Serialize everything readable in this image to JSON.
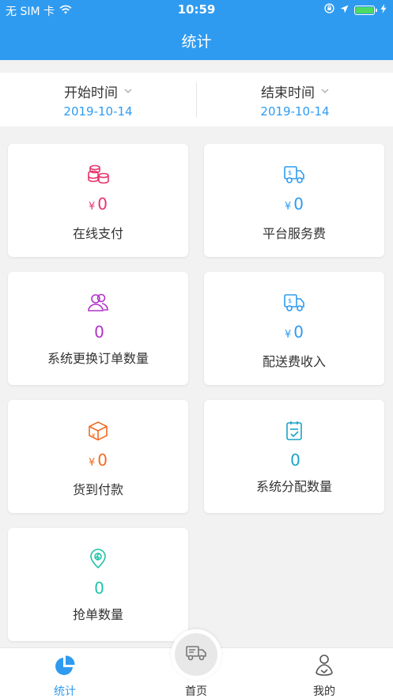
{
  "status_bar": {
    "carrier": "无 SIM 卡",
    "time": "10:59"
  },
  "header": {
    "title": "统计"
  },
  "date_filter": {
    "start_label": "开始时间",
    "start_value": "2019-10-14",
    "end_label": "结束时间",
    "end_value": "2019-10-14"
  },
  "stats": [
    {
      "title": "在线支付",
      "currency": "¥",
      "value": "0",
      "icon": "coins-icon",
      "color": "#e8336c"
    },
    {
      "title": "平台服务费",
      "currency": "¥",
      "value": "0",
      "icon": "delivery-truck-icon",
      "color": "#2f9bf0"
    },
    {
      "title": "系统更换订单数量",
      "currency": "",
      "value": "0",
      "icon": "users-icon",
      "color": "#b232c9"
    },
    {
      "title": "配送费收入",
      "currency": "¥",
      "value": "0",
      "icon": "delivery-truck-icon",
      "color": "#2f9bf0"
    },
    {
      "title": "货到付款",
      "currency": "¥",
      "value": "0",
      "icon": "package-icon",
      "color": "#f26b22"
    },
    {
      "title": "系统分配数量",
      "currency": "",
      "value": "0",
      "icon": "clipboard-check-icon",
      "color": "#1aa3c8"
    },
    {
      "title": "抢单数量",
      "currency": "",
      "value": "0",
      "icon": "grab-order-icon",
      "color": "#1fc3a8"
    }
  ],
  "tabs": [
    {
      "label": "统计",
      "icon": "pie-chart-icon"
    },
    {
      "label": "首页",
      "icon": "truck-icon"
    },
    {
      "label": "我的",
      "icon": "profile-icon"
    }
  ],
  "colors": {
    "accent": "#2f9bf0",
    "background": "#f2f2f2"
  }
}
